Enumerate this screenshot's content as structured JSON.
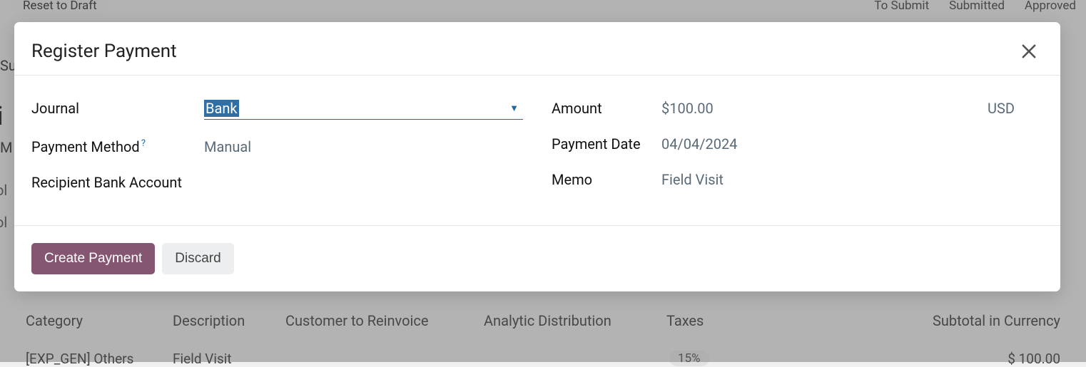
{
  "background": {
    "reset_btn": "Reset to Draft",
    "status": {
      "to_submit": "To Submit",
      "submitted": "Submitted",
      "approved": "Approved"
    },
    "fragments": {
      "su": "Su",
      "i": "i",
      "m": "M",
      "ol": "ol"
    },
    "table_headers": {
      "category": "Category",
      "description": "Description",
      "customer": "Customer to Reinvoice",
      "analytic": "Analytic Distribution",
      "taxes": "Taxes",
      "subtotal": "Subtotal in Currency"
    },
    "row": {
      "category": "[EXP_GEN] Others",
      "description": "Field Visit",
      "tax": "15%",
      "total": "$ 100.00"
    }
  },
  "modal": {
    "title": "Register Payment",
    "labels": {
      "journal": "Journal",
      "payment_method": "Payment Method",
      "recipient_bank": "Recipient Bank Account",
      "amount": "Amount",
      "payment_date": "Payment Date",
      "memo": "Memo",
      "help": "?"
    },
    "values": {
      "journal": "Bank",
      "payment_method": "Manual",
      "recipient_bank": "",
      "amount": "$100.00",
      "currency": "USD",
      "payment_date": "04/04/2024",
      "memo": "Field Visit"
    },
    "buttons": {
      "create": "Create Payment",
      "discard": "Discard"
    }
  }
}
